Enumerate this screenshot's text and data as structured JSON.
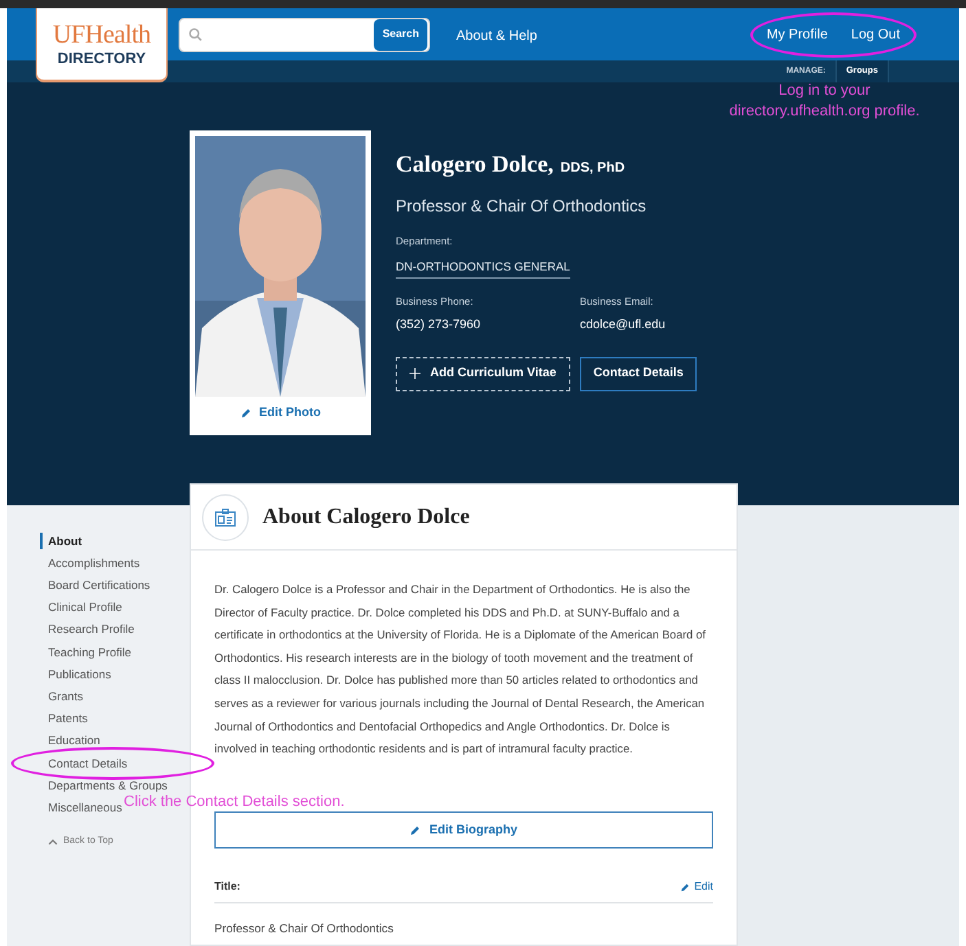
{
  "header": {
    "logo_top": "UFHealth",
    "logo_bottom": "DIRECTORY",
    "search": {
      "button": "Search"
    },
    "nav": [
      {
        "label": "About & Help",
        "circled": false
      }
    ],
    "account": [
      {
        "label": "My Profile",
        "circled": true
      },
      {
        "label": "Log Out",
        "circled": true
      }
    ]
  },
  "subbar": {
    "label": "MANAGE:",
    "link": "Groups"
  },
  "profile": {
    "photo": {
      "kind": "picture",
      "action": "Edit Photo"
    },
    "name": "Calogero Dolce,",
    "credentials": "DDS, PhD",
    "title": "Professor & Chair Of Orthodontics",
    "department_label": "Department:",
    "department": "DN-ORTHODONTICS GENERAL",
    "fields": [
      {
        "label": "Business Phone:",
        "value": "(352) 273-7960"
      },
      {
        "label": "Business Email:",
        "value": "cdolce@ufl.edu"
      }
    ],
    "buttons": [
      {
        "label": "Add Curriculum Vitae",
        "kind": "dashed"
      },
      {
        "label": "Contact Details",
        "kind": "outline"
      }
    ]
  },
  "sidebar": {
    "items": [
      {
        "label": "About",
        "selected": true,
        "circled": false
      },
      {
        "label": "Accomplishments",
        "selected": false,
        "circled": false
      },
      {
        "label": "Board Certifications",
        "selected": false,
        "circled": false
      },
      {
        "label": "Clinical Profile",
        "selected": false,
        "circled": false
      },
      {
        "label": "Research Profile",
        "selected": false,
        "circled": false
      },
      {
        "label": "Teaching Profile",
        "selected": false,
        "circled": false
      },
      {
        "label": "Publications",
        "selected": false,
        "circled": false
      },
      {
        "label": "Grants",
        "selected": false,
        "circled": false
      },
      {
        "label": "Patents",
        "selected": false,
        "circled": false
      },
      {
        "label": "Education",
        "selected": false,
        "circled": false
      },
      {
        "label": "Contact Details",
        "selected": false,
        "circled": true
      },
      {
        "label": "Departments & Groups",
        "selected": false,
        "circled": false
      },
      {
        "label": "Miscellaneous",
        "selected": false,
        "circled": false
      }
    ],
    "back_to_top": "Back to Top"
  },
  "about": {
    "heading": "About Calogero Dolce",
    "bio": "Dr. Calogero Dolce is a Professor and Chair in the Department of Orthodontics. He is also the Director of Faculty practice.  Dr. Dolce completed his DDS and Ph.D. at SUNY-Buffalo and a certificate in orthodontics at the University of Florida.  He is a Diplomate of the American Board of Orthodontics.  His research interests are in the biology of tooth movement and the treatment of class II malocclusion.  Dr. Dolce has published more than 50 articles related to orthodontics and serves as a reviewer for various journals including the Journal of Dental Research, the American Journal of Orthodontics and Dentofacial Orthopedics and Angle Orthodontics.  Dr. Dolce is involved in teaching orthodontic residents and is part of intramural faculty practice.",
    "edit_bio": "Edit Biography",
    "title_label": "Title:",
    "title_edit": "Edit",
    "title_value": "Professor & Chair Of Orthodontics"
  },
  "annotations": {
    "profile_hint": [
      "Log in to your",
      "directory.ufhealth.org profile."
    ],
    "contact_hint": "Click the Contact Details section."
  }
}
